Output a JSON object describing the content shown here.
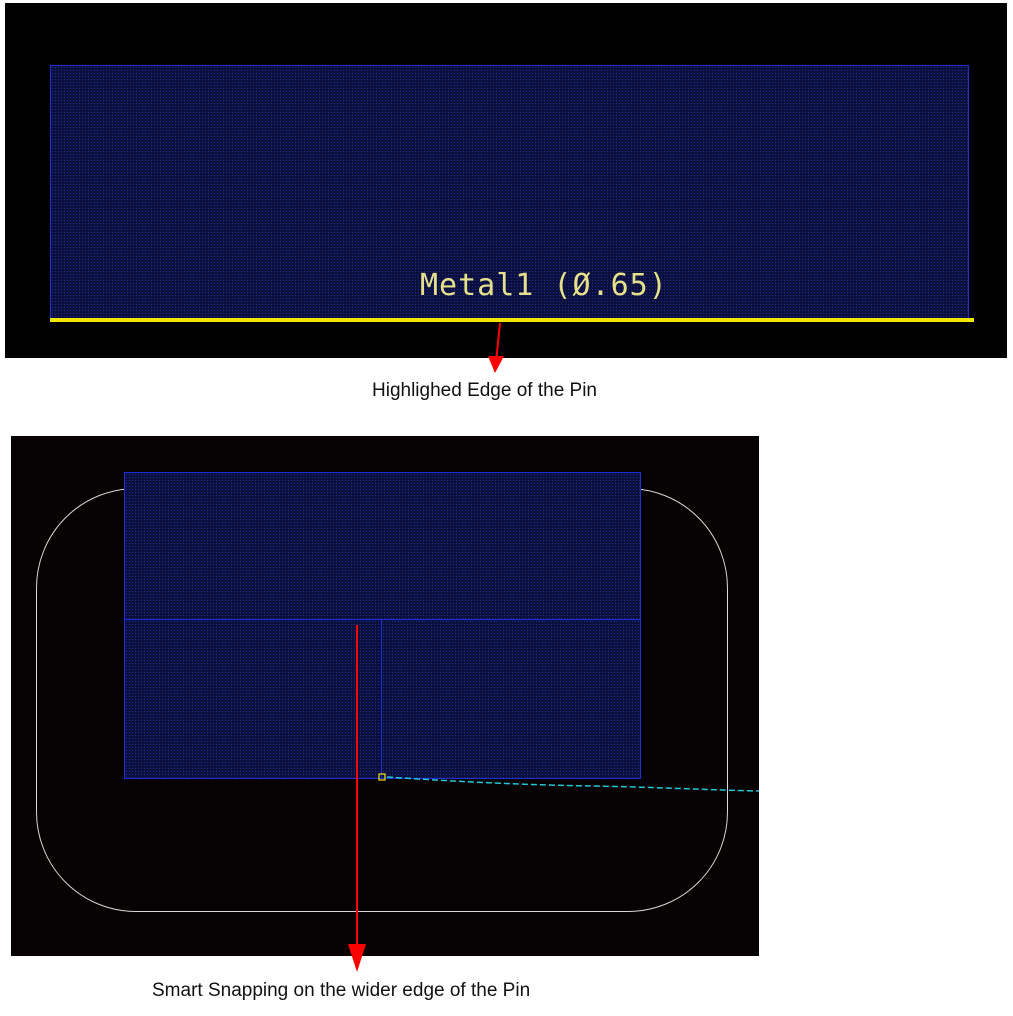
{
  "top_view": {
    "pin_label": "Metal1 (Ø.65)"
  },
  "captions": {
    "top": "Highlighed Edge of the Pin",
    "bottom": "Smart Snapping on the wider edge of the Pin"
  },
  "colors": {
    "canvas_background": "#000000",
    "pin_fill": "#0a0f3c",
    "pin_outline": "#1c2fd6",
    "highlight_edge": "#f2e600",
    "label_text": "#e6e08a",
    "arrow": "#ff0000",
    "boundary_outline": "#d8d8d8",
    "flight_line": "#22c8d8",
    "snap_marker": "#f2e600"
  }
}
